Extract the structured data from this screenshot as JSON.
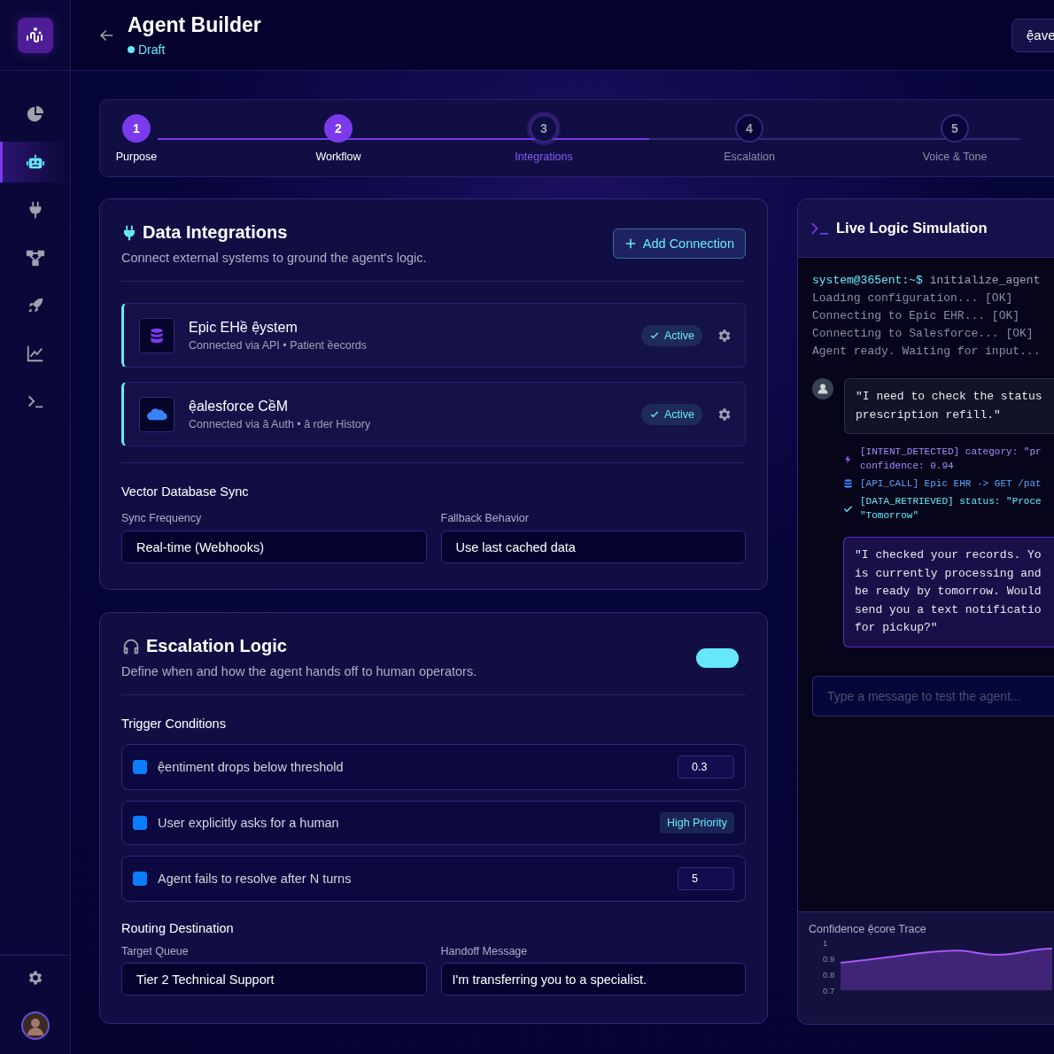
{
  "sidebar": {
    "nav": [
      {
        "selected": false
      },
      {
        "selected": true
      },
      {
        "selected": false
      },
      {
        "selected": false
      },
      {
        "selected": false
      },
      {
        "selected": false
      },
      {
        "selected": false
      }
    ]
  },
  "header": {
    "title": "Agent Builder",
    "status": "Draft",
    "save_button": "ệave"
  },
  "stepper": {
    "level": 0.57,
    "steps": [
      {
        "number": "1",
        "label": "Purpose",
        "completed": true,
        "selected": false
      },
      {
        "number": "2",
        "label": "Workflow",
        "completed": true,
        "selected": false
      },
      {
        "number": "3",
        "label": "Integrations",
        "completed": false,
        "selected": true
      },
      {
        "number": "4",
        "label": "Escalation",
        "completed": false,
        "selected": false
      },
      {
        "number": "5",
        "label": "Voice & Tone",
        "completed": false,
        "selected": false
      }
    ]
  },
  "integrations": {
    "title": "Data Integrations",
    "subtitle": "Connect external systems to ground the agent's logic.",
    "add_button": "Add Connection",
    "connections": [
      {
        "kind": "database",
        "name": "Epic EHề ệystem",
        "detail": "Connected via API • Patient ềecords",
        "badge": "Active"
      },
      {
        "kind": "cloud",
        "name": "ệalesforce CềM",
        "detail": "Connected via ă Auth • ă rder History",
        "badge": "Active"
      }
    ],
    "sync_title": "Vector Database Sync",
    "fields": [
      {
        "label": "Sync Frequency",
        "value": "Real-time (Webhooks)"
      },
      {
        "label": "Fallback Behavior",
        "value": "Use last cached data"
      }
    ]
  },
  "escalation": {
    "title": "Escalation Logic",
    "subtitle": "Define when and how the agent hands off to human operators.",
    "on": true,
    "triggers_title": "Trigger Conditions",
    "triggers": [
      {
        "label": "ệentiment drops below threshold",
        "checked": true,
        "kind": "input",
        "value": "0.3"
      },
      {
        "label": "User explicitly asks for a human",
        "checked": true,
        "kind": "badge",
        "value": "High Priority"
      },
      {
        "label": "Agent fails to resolve after N turns",
        "checked": true,
        "kind": "input",
        "value": "5"
      }
    ],
    "routing_title": "Routing Destination",
    "fields": [
      {
        "label": "Target Queue",
        "value": "Tier 2 Technical Support"
      },
      {
        "label": "Handoff Message",
        "value": "I'm transferring you to a specialist."
      }
    ]
  },
  "simulation": {
    "title": "Live Logic Simulation",
    "console": [
      {
        "kind": "prompt",
        "text": "system@365ent:~$",
        "command": "initialize_agent"
      },
      {
        "kind": "plain",
        "text": "Loading configuration... [OK]"
      },
      {
        "kind": "plain",
        "text": "Connecting to Epic EHR... [OK]"
      },
      {
        "kind": "plain",
        "text": "Connecting to Salesforce... [OK]"
      },
      {
        "kind": "plain",
        "text": "Agent ready. Waiting for input..."
      }
    ],
    "user_message": [
      "\"I need to check the status",
      "prescription refill.\""
    ],
    "logs": [
      {
        "kind": "intent",
        "lines": [
          "[INTENT_DETECTED] category: \"pr",
          "confidence: 0.94"
        ]
      },
      {
        "kind": "api",
        "lines": [
          "[API_CALL] Epic EHR -> GET /pat"
        ]
      },
      {
        "kind": "data",
        "lines": [
          "[DATA_RETRIEVED] status: \"Proce",
          "\"Tomorrow\""
        ]
      }
    ],
    "agent_message": [
      "\"I checked your records. Yo",
      "is currently processing and",
      "be ready by tomorrow. Would",
      "send you a text notificatio",
      "for pickup?\""
    ],
    "input_placeholder": "Type a message to test the agent...",
    "chart_title": "Confidence ệcore Trace",
    "trace_axis_labels": [
      "1",
      "0.9",
      "0.8",
      "0.7"
    ]
  }
}
